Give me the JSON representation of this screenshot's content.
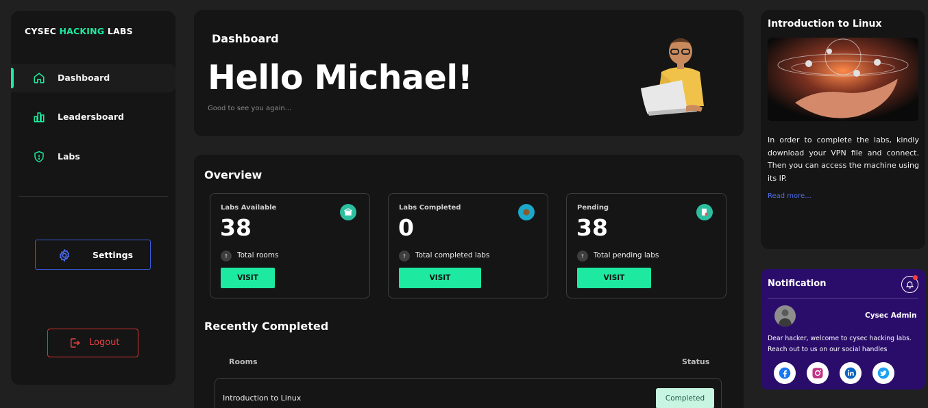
{
  "brand": {
    "part1": "CYSEC",
    "part2": "HACKING",
    "part3": "LABS"
  },
  "sidebar": {
    "items": [
      {
        "label": "Dashboard",
        "icon": "home-icon"
      },
      {
        "label": "Leadersboard",
        "icon": "chart-icon"
      },
      {
        "label": "Labs",
        "icon": "shield-icon"
      }
    ],
    "settings_label": "Settings",
    "logout_label": "Logout"
  },
  "hero": {
    "title": "Dashboard",
    "greeting": "Hello Michael!",
    "tagline": "Good to see you again..."
  },
  "overview": {
    "title": "Overview",
    "cards": [
      {
        "title": "Labs Available",
        "value": "38",
        "meta": "Total rooms",
        "button": "VISIT"
      },
      {
        "title": "Labs Completed",
        "value": "0",
        "meta": "Total completed labs",
        "button": "VISIT"
      },
      {
        "title": "Pending",
        "value": "38",
        "meta": "Total pending labs",
        "button": "VISIT"
      }
    ],
    "arrow_symbol": "↑"
  },
  "recent": {
    "title": "Recently Completed",
    "headers": {
      "rooms": "Rooms",
      "status": "Status"
    },
    "rows": [
      {
        "name": "Introduction to Linux",
        "status": "Completed"
      }
    ]
  },
  "intro": {
    "title": "Introduction to Linux",
    "description": "In order to complete the labs, kindly download your VPN file and connect. Then you can access the machine using its IP.",
    "read_more": "Read more..."
  },
  "notification": {
    "title": "Notification",
    "sender": "Cysec Admin",
    "message": "Dear hacker, welcome to cysec hacking labs. Reach out to us on our social handles",
    "socials": [
      "facebook-icon",
      "instagram-icon",
      "linkedin-icon",
      "twitter-icon"
    ]
  },
  "colors": {
    "accent": "#1de9a0",
    "settings_border": "#3b5bdb",
    "logout": "#e03535",
    "notification_bg": "#2a0d6b"
  }
}
